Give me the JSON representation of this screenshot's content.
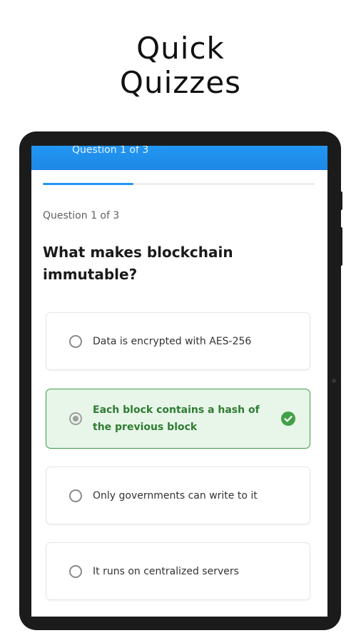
{
  "promo": {
    "title_line1": "Quick",
    "title_line2": "Quizzes"
  },
  "app_bar": {
    "title": "Question 1 of 3"
  },
  "progress": {
    "fraction": 0.333,
    "color": "#2196f3"
  },
  "question": {
    "counter": "Question 1 of 3",
    "text": "What makes blockchain immutable?"
  },
  "options": [
    {
      "label": "Data is encrypted with AES-256",
      "selected": false
    },
    {
      "label": "Each block contains a hash of the previous block",
      "selected": true,
      "status_icon": "check-circle-icon"
    },
    {
      "label": "Only governments can write to it",
      "selected": false
    },
    {
      "label": "It runs on centralized servers",
      "selected": false
    }
  ],
  "colors": {
    "accent": "#2196f3",
    "correct": "#43a047",
    "correct_bg": "#e8f5e9"
  }
}
